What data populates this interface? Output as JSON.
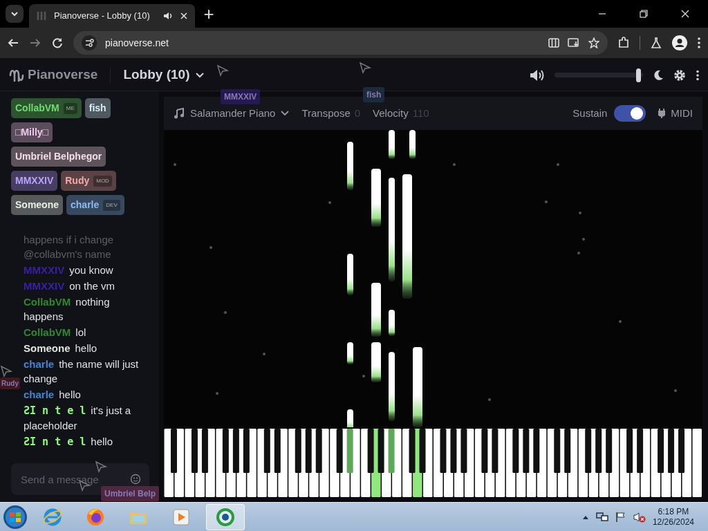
{
  "browser": {
    "tab_title": "Pianoverse - Lobby (10)",
    "new_tab": "+",
    "address": "pianoverse.net"
  },
  "app": {
    "brand": "Pianoverse",
    "room": "Lobby (10)",
    "volume": {
      "level": 0.98
    }
  },
  "users": [
    {
      "name": "CollabVM",
      "badge": "ME",
      "color": "#6fdc6f"
    },
    {
      "name": "fish",
      "color": "#d6ecf8"
    },
    {
      "name": "□Milly□",
      "color": "#f2c8ee"
    },
    {
      "name": "Umbriel Belphegor",
      "color": "#f7dbe8"
    },
    {
      "name": "MMXXIV",
      "color": "#b9a2ff"
    },
    {
      "name": "Rudy",
      "badge": "MOD",
      "color": "#f2aaa8"
    },
    {
      "name": "Someone",
      "color": "#e6eee6"
    },
    {
      "name": "charle",
      "badge": "DEV",
      "color": "#8cbaf2"
    }
  ],
  "messages": [
    {
      "text": "happens if i change @collabvm's name",
      "faded": true
    },
    {
      "author": "MMXXIV",
      "color": "#3a1fa8",
      "text": "you know",
      "faded": false
    },
    {
      "author": "MMXXIV",
      "color": "#3a1fa8",
      "text": "on the vm",
      "faded": false
    },
    {
      "author": "CollabVM",
      "color": "#2e8a2e",
      "text": "nothing happens",
      "faded": false
    },
    {
      "author": "CollabVM",
      "color": "#2e8a2e",
      "text": "lol",
      "faded": false
    },
    {
      "author": "Someone",
      "color": "#dfe6df",
      "text": "hello",
      "faded": false
    },
    {
      "author": "charle",
      "color": "#3f86d6",
      "text": "the name will just change",
      "faded": false
    },
    {
      "author": "charle",
      "color": "#3f86d6",
      "text": "hello",
      "faded": false
    },
    {
      "author": "ƧI n t e l",
      "kind": "mono",
      "color": "#8cff7a",
      "text": "it's just a placeholder",
      "faded": false
    },
    {
      "author": "ƧI n t e l",
      "kind": "mono",
      "color": "#8cff7a",
      "text": "hello",
      "faded": false
    }
  ],
  "message_input": {
    "placeholder": "Send a message"
  },
  "toolbar": {
    "instrument": "Salamander Piano",
    "transpose_label": "Transpose",
    "transpose": "0",
    "velocity_label": "Velocity",
    "velocity": "110",
    "sustain_label": "Sustain",
    "sustain_on": true,
    "midi": "MIDI"
  },
  "cursors": [
    {
      "label": "MMXXIV",
      "color": "#2a1a5a"
    },
    {
      "label": "fish",
      "color": "#1e3040"
    },
    {
      "label": "Rudy",
      "color": "#4a1a1e"
    },
    {
      "label": "Umbriel Belp",
      "color": "#5a2a44"
    }
  ],
  "keyboard": {
    "keys": [
      {
        "pressed": false
      },
      {
        "pressed": false
      },
      {
        "pressed": false
      },
      {
        "pressed": false
      },
      {
        "pressed": false
      },
      {
        "pressed": false
      },
      {
        "pressed": false
      },
      {
        "pressed": false
      },
      {
        "pressed": false
      },
      {
        "pressed": false
      },
      {
        "pressed": false
      },
      {
        "pressed": false
      },
      {
        "pressed": false
      },
      {
        "pressed": false
      },
      {
        "pressed": false
      },
      {
        "pressed": false
      },
      {
        "pressed": false
      },
      {
        "pressed": false
      },
      {
        "pressed": false
      },
      {
        "pressed": false
      },
      {
        "pressed": false
      },
      {
        "pressed": false
      },
      {
        "pressed": false
      },
      {
        "pressed": false
      },
      {
        "pressed": false
      },
      {
        "pressed": false
      },
      {
        "pressed": false
      },
      {
        "pressed": false
      },
      {
        "pressed": false
      },
      {
        "pressed": false
      },
      {
        "pressed": true
      },
      {
        "pressed": false
      },
      {
        "pressed": false
      },
      {
        "pressed": false
      },
      {
        "pressed": true
      },
      {
        "pressed": false
      },
      {
        "pressed": false
      },
      {
        "pressed": true
      },
      {
        "pressed": false
      },
      {
        "pressed": false
      },
      {
        "pressed": false
      },
      {
        "pressed": true
      },
      {
        "pressed": false
      },
      {
        "pressed": false
      },
      {
        "pressed": false
      },
      {
        "pressed": false
      },
      {
        "pressed": false
      },
      {
        "pressed": false
      },
      {
        "pressed": false
      },
      {
        "pressed": false
      },
      {
        "pressed": false
      },
      {
        "pressed": false
      },
      {
        "pressed": false
      },
      {
        "pressed": false
      },
      {
        "pressed": false
      },
      {
        "pressed": false
      },
      {
        "pressed": false
      },
      {
        "pressed": false
      },
      {
        "pressed": false
      },
      {
        "pressed": false
      },
      {
        "pressed": false
      },
      {
        "pressed": false
      },
      {
        "pressed": false
      },
      {
        "pressed": false
      },
      {
        "pressed": false
      },
      {
        "pressed": false
      },
      {
        "pressed": false
      },
      {
        "pressed": false
      },
      {
        "pressed": false
      },
      {
        "pressed": false
      },
      {
        "pressed": false
      },
      {
        "pressed": false
      },
      {
        "pressed": false
      },
      {
        "pressed": false
      },
      {
        "pressed": false
      },
      {
        "pressed": false
      },
      {
        "pressed": false
      },
      {
        "pressed": false
      },
      {
        "pressed": false
      },
      {
        "pressed": false
      },
      {
        "pressed": false
      },
      {
        "pressed": false
      },
      {
        "pressed": false
      },
      {
        "pressed": false
      },
      {
        "pressed": false
      },
      {
        "pressed": false
      },
      {
        "pressed": false
      },
      {
        "pressed": false
      }
    ]
  },
  "taskbar": {
    "time": "6:18 PM",
    "date": "12/26/2024"
  }
}
